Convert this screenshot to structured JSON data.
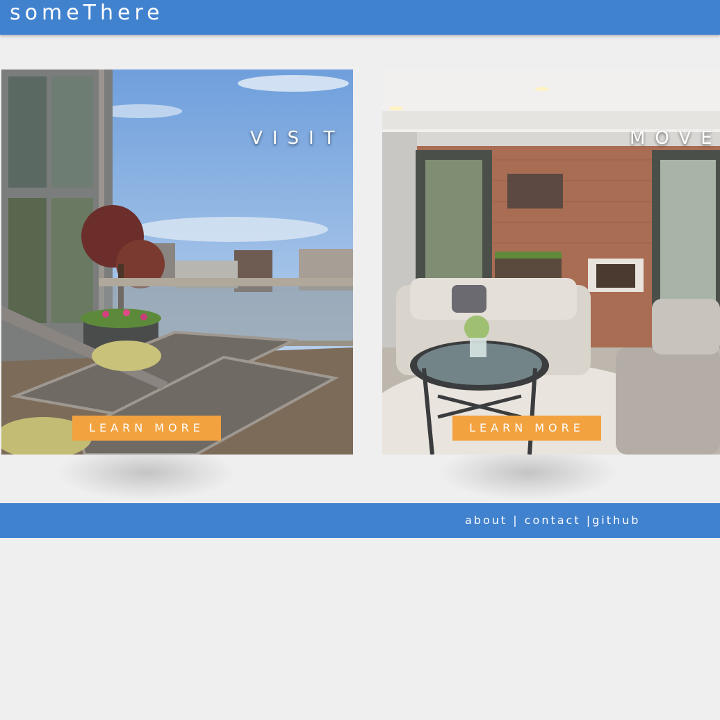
{
  "header": {
    "brand": "someThere"
  },
  "cards": [
    {
      "title": "VISIT",
      "button_label": "LEARN MORE"
    },
    {
      "title": "MOVE",
      "button_label": "LEARN MORE"
    }
  ],
  "footer": {
    "links": [
      "about",
      "contact",
      "github"
    ],
    "separator": " |"
  },
  "colors": {
    "header": "#4182cf",
    "button": "#f2a23f",
    "background": "#efefef"
  }
}
